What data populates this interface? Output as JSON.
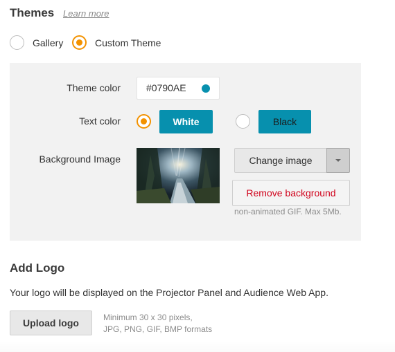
{
  "themes": {
    "title": "Themes",
    "learn_more": "Learn more",
    "options": [
      {
        "label": "Gallery",
        "checked": false
      },
      {
        "label": "Custom Theme",
        "checked": true
      }
    ]
  },
  "custom_theme": {
    "theme_color_label": "Theme color",
    "theme_color_value": "#0790AE",
    "theme_color_hex": "#0790ae",
    "text_color_label": "Text color",
    "text_color_options": [
      {
        "label": "White",
        "checked": true
      },
      {
        "label": "Black",
        "checked": false
      }
    ],
    "background_image_label": "Background Image",
    "change_image_label": "Change image",
    "remove_background_label": "Remove background",
    "background_hint": "non-animated GIF. Max 5Mb."
  },
  "logo": {
    "title": "Add Logo",
    "description": "Your logo will be displayed on the Projector Panel and Audience Web App.",
    "upload_label": "Upload logo",
    "requirements_line1": "Minimum 30 x 30 pixels,",
    "requirements_line2": "JPG, PNG, GIF, BMP formats"
  },
  "colors": {
    "accent": "#f39200",
    "primary": "#0790ae",
    "danger": "#d0021b",
    "panel_bg": "#f2f2f2"
  },
  "icons": {
    "swatch": "color-swatch-icon",
    "dropdown": "caret-down-icon"
  }
}
